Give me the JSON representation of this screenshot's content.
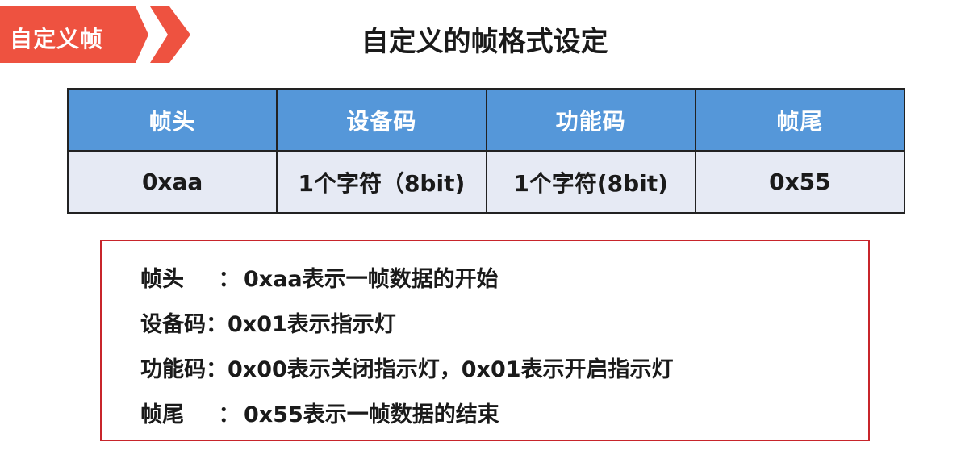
{
  "tag": {
    "label": "自定义帧",
    "color": "#ee5240"
  },
  "title": "自定义的帧格式设定",
  "table": {
    "header_color": "#5597d9",
    "cell_color": "#e6eaf4",
    "headers": [
      "帧头",
      "设备码",
      "功能码",
      "帧尾"
    ],
    "values": [
      "0xaa",
      "1个字符（8bit)",
      "1个字符(8bit)",
      "0x55"
    ]
  },
  "notes": {
    "border_color": "#c8252b",
    "items": [
      {
        "key": "帧头",
        "sep": "：",
        "text": "0xaa表示一帧数据的开始"
      },
      {
        "key": "设备码",
        "sep": "：",
        "text": "0x01表示指示灯"
      },
      {
        "key": "功能码",
        "sep": "：",
        "text": "0x00表示关闭指示灯，0x01表示开启指示灯"
      },
      {
        "key": "帧尾",
        "sep": "：",
        "text": "0x55表示一帧数据的结束"
      }
    ]
  }
}
